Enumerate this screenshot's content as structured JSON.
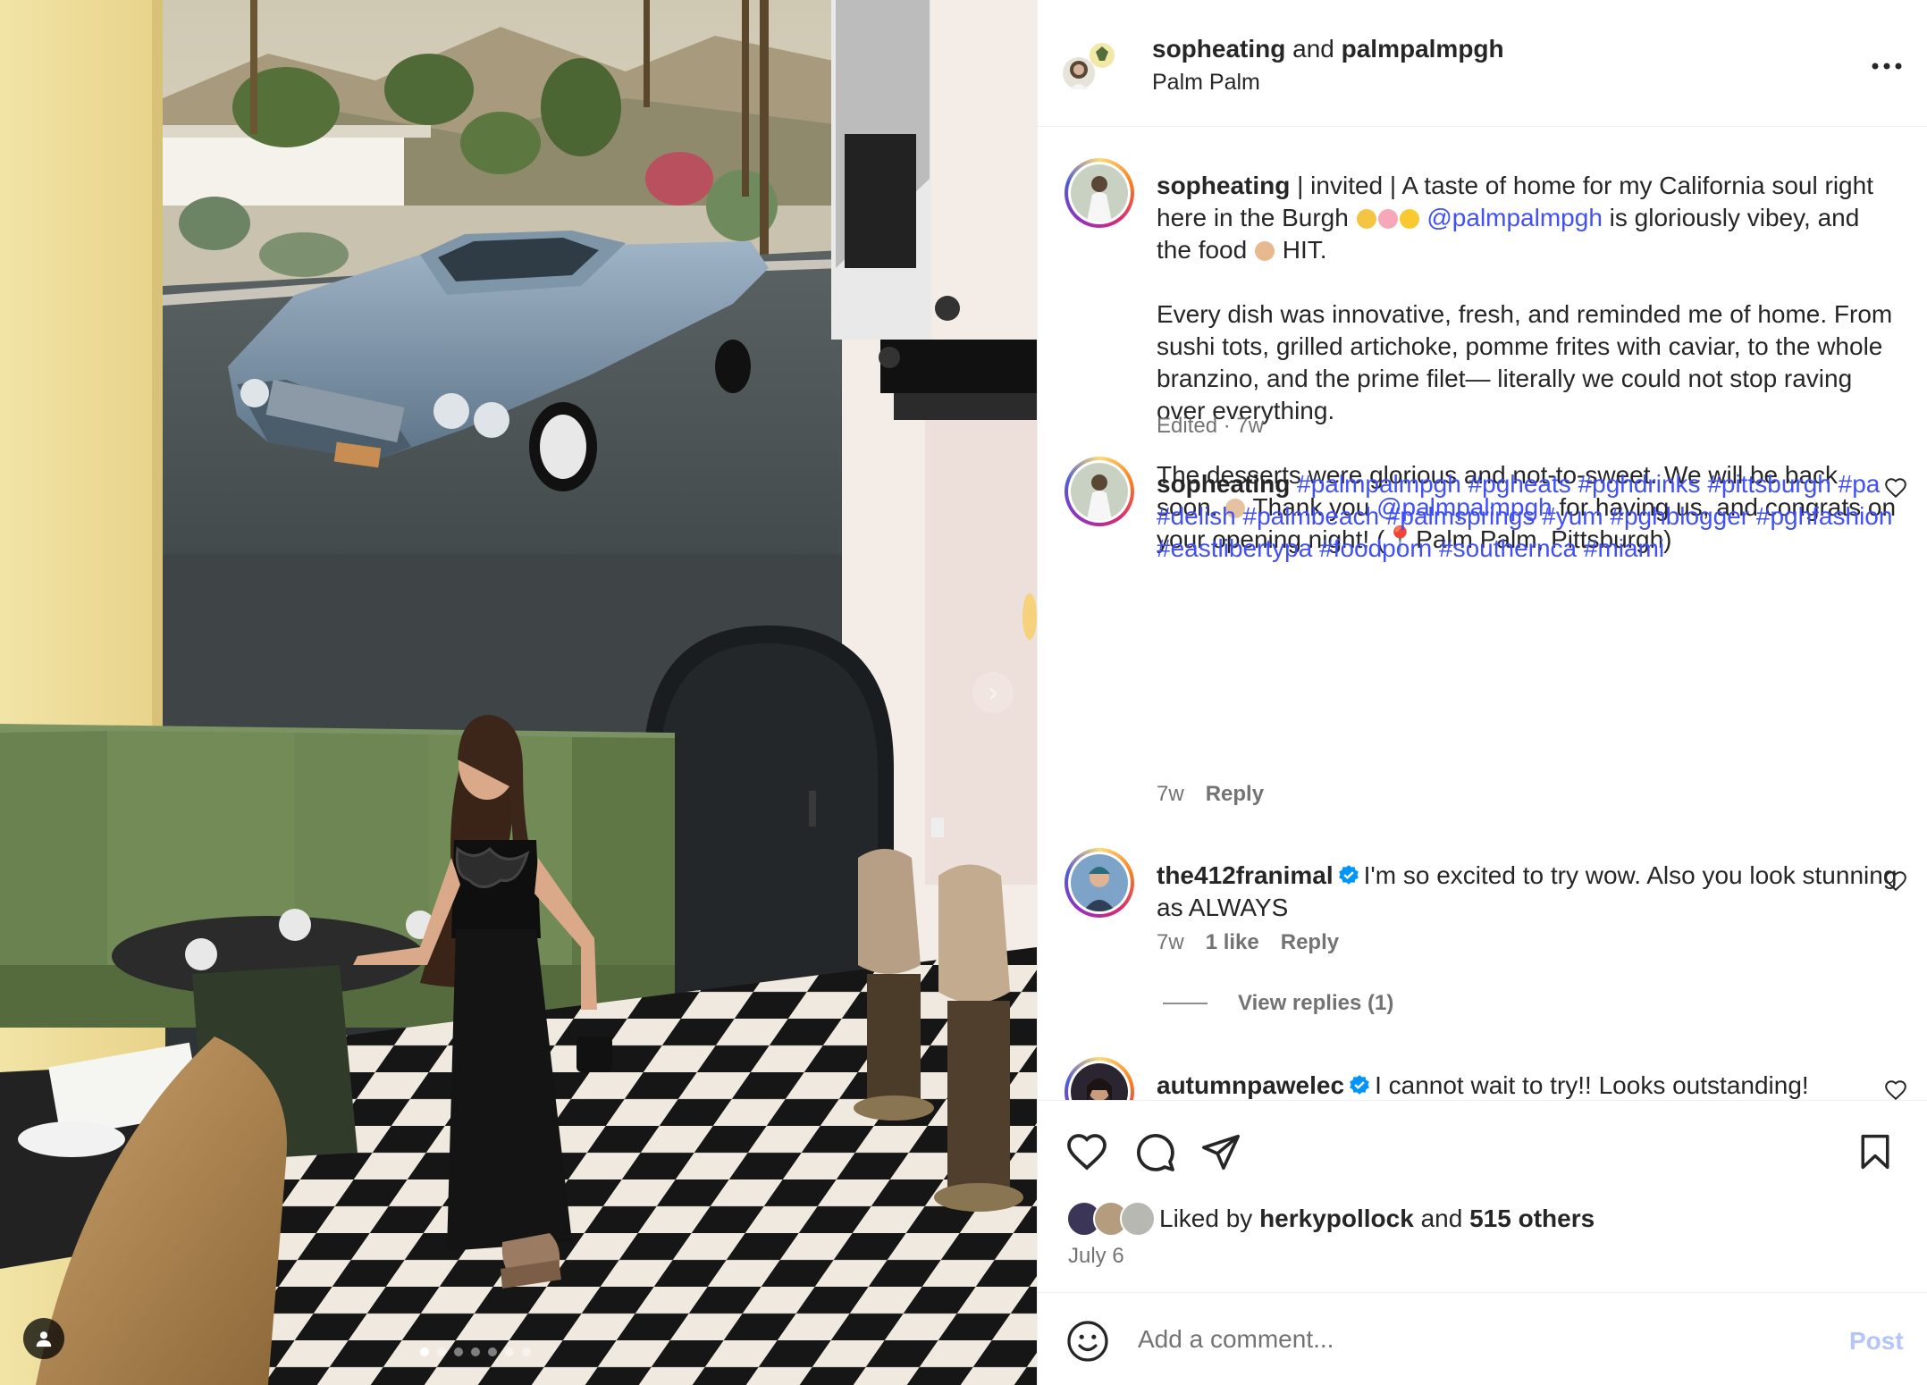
{
  "post": {
    "author1": "sopheating",
    "joiner": "and",
    "author2": "palmpalmpgh",
    "location": "Palm Palm",
    "more_icon": "more-horizontal-icon"
  },
  "caption": {
    "username": "sopheating",
    "text_1": " | invited | A taste of home for my California soul right here in the Burgh ",
    "mention_1": "@palmpalmpgh",
    "text_2": " is gloriously vibey, and the food ",
    "text_3": " HIT.",
    "para_2": "Every dish was innovative, fresh, and reminded me of home. From sushi tots, grilled artichoke, pomme frites with caviar, to the whole branzino, and the prime filet— literally we could not stop raving over everything.",
    "para_3a": "The desserts were glorious and not-to-sweet. We will be back soon. ",
    "para_3b": " Thank you ",
    "mention_2": "@palmpalmpgh",
    "para_3c": " for having us, and congrats on your opening night! (",
    "para_3d": "Palm Palm, Pittsburgh)",
    "meta": "Edited · 7w"
  },
  "comments": [
    {
      "username": "sopheating",
      "hashtags": "#palmpalmpgh #pgheats #pghdrinks #pittsburgh #pa #delish #palmbeach #palmsprings #yum #pghblogger #pghfashion #eastlibertypa #foodporn #southernca #miami",
      "time": "7w",
      "reply": "Reply"
    },
    {
      "username": "the412franimal",
      "text": "I'm so excited to try wow. Also you look stunning as ALWAYS",
      "time": "7w",
      "likes": "1 like",
      "reply": "Reply",
      "view_replies": "View replies (1)"
    },
    {
      "username": "autumnpawelec",
      "text": "I cannot wait to try!! Looks outstanding!"
    }
  ],
  "actions": {
    "liked_by": "Liked by",
    "liker": "herkypollock",
    "and": "and",
    "others": "515 others",
    "date": "July 6"
  },
  "composer": {
    "placeholder": "Add a comment...",
    "post_label": "Post"
  },
  "colors": {
    "link": "#4150f7",
    "muted": "#737373",
    "post_disabled": "#b3c5fb",
    "verified": "#0095f6"
  },
  "carousel": {
    "count": 7,
    "active": 0
  }
}
